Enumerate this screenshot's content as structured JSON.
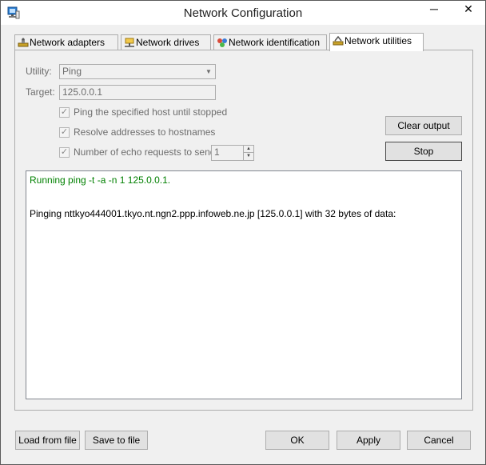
{
  "window": {
    "title": "Network Configuration",
    "minimize_glyph": "─",
    "close_glyph": "✕"
  },
  "tabs": [
    {
      "label": "Network adapters",
      "icon": "network-adapter-icon"
    },
    {
      "label": "Network drives",
      "icon": "network-drive-icon"
    },
    {
      "label": "Network identification",
      "icon": "network-identification-icon"
    },
    {
      "label": "Network utilities",
      "icon": "network-utilities-icon",
      "active": true
    }
  ],
  "utility": {
    "label": "Utility:",
    "value": "Ping"
  },
  "target": {
    "label": "Target:",
    "value": "125.0.0.1"
  },
  "options": {
    "ping_until_stopped": {
      "label": "Ping the specified host until stopped",
      "checked": true
    },
    "resolve_addresses": {
      "label": "Resolve addresses to hostnames",
      "checked": true
    },
    "echo_requests": {
      "label": "Number of echo requests to send:",
      "checked": true,
      "value": "1"
    }
  },
  "buttons": {
    "clear_output": "Clear output",
    "stop": "Stop",
    "load_from_file": "Load from file",
    "save_to_file": "Save to file",
    "ok": "OK",
    "apply": "Apply",
    "cancel": "Cancel"
  },
  "output": {
    "command_line": "Running ping -t -a -n 1 125.0.0.1.",
    "result_line": "Pinging nttkyo444001.tkyo.nt.ngn2.ppp.infoweb.ne.jp [125.0.0.1] with 32 bytes of data:"
  },
  "colors": {
    "command_text": "#008000",
    "disabled_text": "#6d6d6d",
    "window_bg": "#f0f0f0"
  }
}
